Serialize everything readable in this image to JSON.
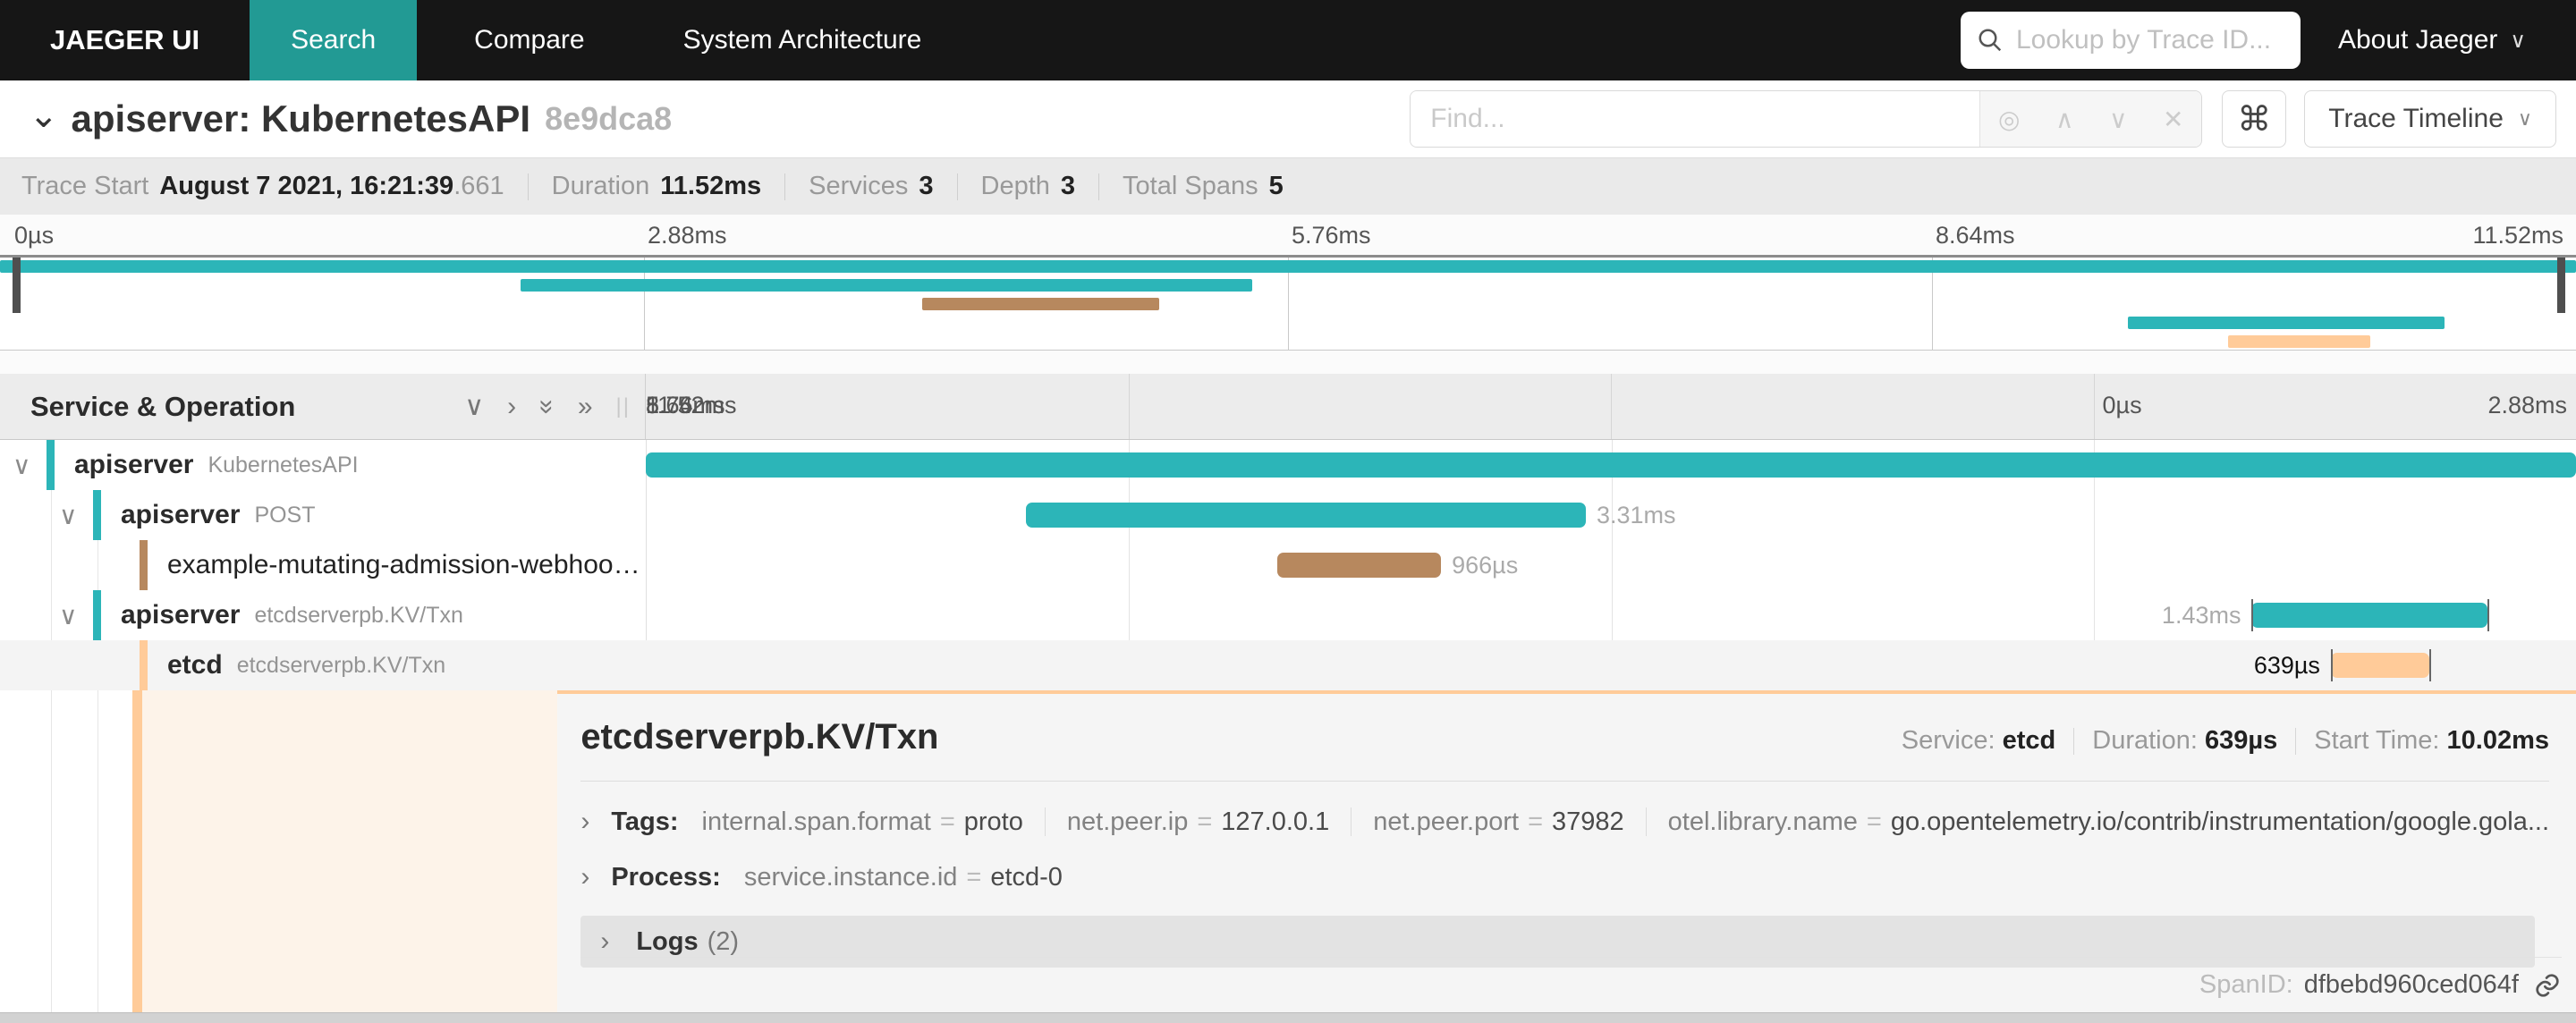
{
  "nav": {
    "brand": "JAEGER UI",
    "items": [
      {
        "label": "Search",
        "active": true
      },
      {
        "label": "Compare",
        "active": false
      },
      {
        "label": "System Architecture",
        "active": false
      }
    ],
    "lookup_placeholder": "Lookup by Trace ID...",
    "about_label": "About Jaeger",
    "active_color": "#229a94",
    "bg_color": "#161616"
  },
  "trace_header": {
    "title": "apiserver: KubernetesAPI",
    "trace_id_short": "8e9dca8",
    "find_placeholder": "Find...",
    "view_selector_label": "Trace Timeline"
  },
  "summary": {
    "trace_start_label": "Trace Start",
    "trace_start_value": "August 7 2021, 16:21:39",
    "trace_start_ms": ".661",
    "duration_label": "Duration",
    "duration_value": "11.52ms",
    "services_label": "Services",
    "services_value": "3",
    "depth_label": "Depth",
    "depth_value": "3",
    "total_spans_label": "Total Spans",
    "total_spans_value": "5"
  },
  "timeline": {
    "column_header": "Service & Operation",
    "ticks": [
      "0µs",
      "2.88ms",
      "5.76ms",
      "8.64ms",
      "11.52ms"
    ]
  },
  "minimap": {
    "spans": [
      {
        "start": 0,
        "width": 100,
        "color": "#2cb5b8"
      },
      {
        "start": 20.2,
        "width": 28.4,
        "color": "#2cb5b8"
      },
      {
        "start": 35.8,
        "width": 9.2,
        "color": "#b7885e"
      },
      {
        "start": 82.6,
        "width": 12.3,
        "color": "#2cb5b8"
      },
      {
        "start": 86.5,
        "width": 5.5,
        "color": "#ffcb99"
      }
    ]
  },
  "spans": [
    {
      "service": "apiserver",
      "operation": "KubernetesAPI",
      "depth": 0,
      "color": "#2cb5b8",
      "bar": {
        "start": 0,
        "width": 100,
        "label": "",
        "label_side": "right",
        "edge_ticks": false
      }
    },
    {
      "service": "apiserver",
      "operation": "POST",
      "depth": 1,
      "color": "#2cb5b8",
      "bar": {
        "start": 19.7,
        "width": 29.0,
        "label": "3.31ms",
        "label_side": "right",
        "edge_ticks": false
      }
    },
    {
      "service": "example-mutating-admission-webhook...",
      "operation": "",
      "depth": 2,
      "color": "#b7885e",
      "bar": {
        "start": 32.7,
        "width": 8.5,
        "label": "966µs",
        "label_side": "right",
        "edge_ticks": false
      }
    },
    {
      "service": "apiserver",
      "operation": "etcdserverpb.KV/Txn",
      "depth": 1,
      "color": "#2cb5b8",
      "bar": {
        "start": 83.2,
        "width": 12.2,
        "label": "1.43ms",
        "label_side": "left",
        "edge_ticks": true
      }
    },
    {
      "service": "etcd",
      "operation": "etcdserverpb.KV/Txn",
      "depth": 2,
      "color": "#ffcb99",
      "selected": true,
      "bar": {
        "start": 87.3,
        "width": 5.1,
        "label": "639µs",
        "label_side": "left",
        "edge_ticks": true
      }
    }
  ],
  "detail": {
    "accent_color": "#ffcb99",
    "operation": "etcdserverpb.KV/Txn",
    "service_label": "Service:",
    "service_value": "etcd",
    "duration_label": "Duration:",
    "duration_value": "639µs",
    "start_label": "Start Time:",
    "start_value": "10.02ms",
    "tags_label": "Tags:",
    "tags": [
      {
        "key": "internal.span.format",
        "value": "proto"
      },
      {
        "key": "net.peer.ip",
        "value": "127.0.0.1"
      },
      {
        "key": "net.peer.port",
        "value": "37982"
      },
      {
        "key": "otel.library.name",
        "value": "go.opentelemetry.io/contrib/instrumentation/google.gola..."
      }
    ],
    "process_label": "Process:",
    "process": {
      "key": "service.instance.id",
      "value": "etcd-0"
    },
    "logs_label": "Logs",
    "logs_count": "(2)",
    "span_id_label": "SpanID:",
    "span_id_value": "dfbebd960ced064f"
  }
}
